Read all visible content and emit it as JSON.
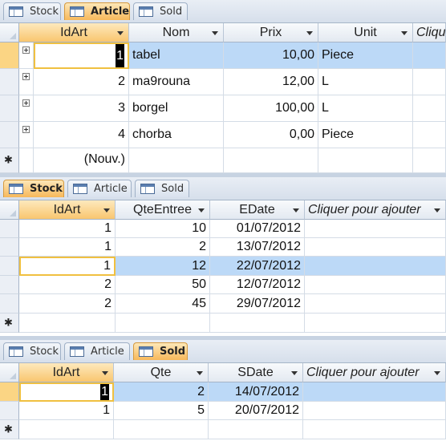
{
  "panels": {
    "article": {
      "tabs": [
        "Stock",
        "Article",
        "Sold"
      ],
      "active_tab": "Article",
      "columns": [
        "IdArt",
        "Nom",
        "Prix",
        "Unit",
        "Clique"
      ],
      "rows": [
        {
          "idart": "1",
          "nom": "tabel",
          "prix": "10,00",
          "unit": "Piece"
        },
        {
          "idart": "2",
          "nom": "ma9rouna",
          "prix": "12,00",
          "unit": "L"
        },
        {
          "idart": "3",
          "nom": "borgel",
          "prix": "100,00",
          "unit": "L"
        },
        {
          "idart": "4",
          "nom": "chorba",
          "prix": "0,00",
          "unit": "Piece"
        }
      ],
      "new_row_label": "(Nouv.)"
    },
    "stock": {
      "tabs": [
        "Stock",
        "Article",
        "Sold"
      ],
      "active_tab": "Stock",
      "columns": [
        "IdArt",
        "QteEntree",
        "EDate",
        "Cliquer pour ajouter"
      ],
      "rows": [
        {
          "idart": "1",
          "qte": "10",
          "date": "01/07/2012"
        },
        {
          "idart": "1",
          "qte": "2",
          "date": "13/07/2012"
        },
        {
          "idart": "1",
          "qte": "12",
          "date": "22/07/2012"
        },
        {
          "idart": "2",
          "qte": "50",
          "date": "12/07/2012"
        },
        {
          "idart": "2",
          "qte": "45",
          "date": "29/07/2012"
        }
      ]
    },
    "sold": {
      "tabs": [
        "Stock",
        "Article",
        "Sold"
      ],
      "active_tab": "Sold",
      "columns": [
        "IdArt",
        "Qte",
        "SDate",
        "Cliquer pour ajouter"
      ],
      "rows": [
        {
          "idart": "1",
          "qte": "2",
          "date": "14/07/2012"
        },
        {
          "idart": "1",
          "qte": "5",
          "date": "20/07/2012"
        }
      ]
    }
  },
  "colors": {
    "active_tab": "#f7b85a",
    "selected_row": "#bcd9f7",
    "current_record": "#fbd584",
    "focus_border": "#f0c040"
  }
}
